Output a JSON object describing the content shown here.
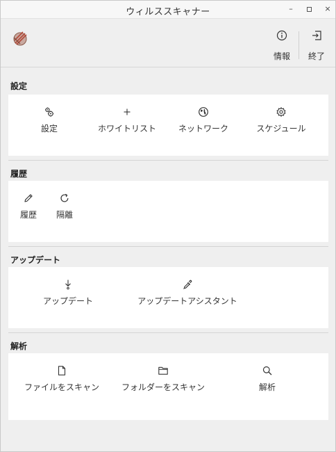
{
  "window": {
    "title": "ウィルススキャナー"
  },
  "toolbar": {
    "info_label": "情報",
    "exit_label": "終了"
  },
  "sections": [
    {
      "title": "設定",
      "items": [
        {
          "label": "設定",
          "icon": "gears-icon"
        },
        {
          "label": "ホワイトリスト",
          "icon": "plus-icon"
        },
        {
          "label": "ネットワーク",
          "icon": "globe-icon"
        },
        {
          "label": "スケジュール",
          "icon": "gear-icon"
        }
      ]
    },
    {
      "title": "履歴",
      "items": [
        {
          "label": "履歴",
          "icon": "pencil-icon"
        },
        {
          "label": "隔離",
          "icon": "refresh-icon"
        }
      ]
    },
    {
      "title": "アップデート",
      "items": [
        {
          "label": "アップデート",
          "icon": "download-arrow-icon"
        },
        {
          "label": "アップデートアシスタント",
          "icon": "dropper-icon"
        }
      ]
    },
    {
      "title": "解析",
      "items": [
        {
          "label": "ファイルをスキャン",
          "icon": "file-icon"
        },
        {
          "label": "フォルダーをスキャン",
          "icon": "folder-icon"
        },
        {
          "label": "解析",
          "icon": "search-icon"
        }
      ]
    }
  ]
}
